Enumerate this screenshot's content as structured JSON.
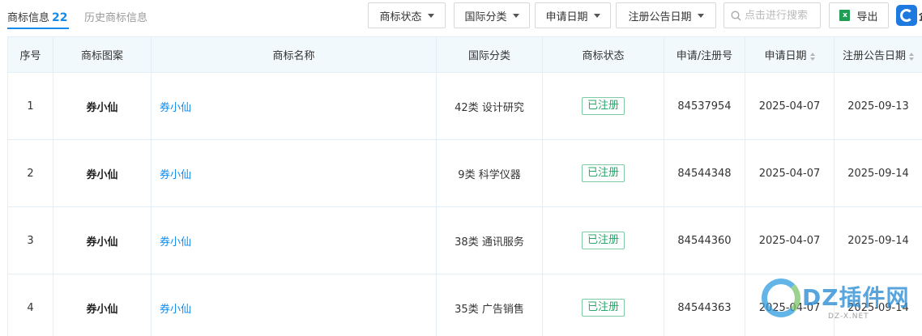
{
  "tabs": {
    "active_label": "商标信息",
    "active_count": "22",
    "history_label": "历史商标信息"
  },
  "filters": {
    "status": "商标状态",
    "intl_class": "国际分类",
    "apply_date": "申请日期",
    "announce_date": "注册公告日期"
  },
  "search": {
    "placeholder": "点击进行搜索"
  },
  "export": {
    "label": "导出",
    "icon": "excel-icon"
  },
  "table": {
    "headers": {
      "index": "序号",
      "pattern": "商标图案",
      "name": "商标名称",
      "intl_class": "国际分类",
      "status": "商标状态",
      "reg_no": "申请/注册号",
      "apply_date": "申请日期",
      "announce_date": "注册公告日期"
    },
    "rows": [
      {
        "index": "1",
        "pattern": "券小仙",
        "name": "券小仙",
        "intl_class": "42类 设计研究",
        "status": "已注册",
        "reg_no": "84537954",
        "apply_date": "2025-04-07",
        "announce_date": "2025-09-13"
      },
      {
        "index": "2",
        "pattern": "券小仙",
        "name": "券小仙",
        "intl_class": "9类 科学仪器",
        "status": "已注册",
        "reg_no": "84544348",
        "apply_date": "2025-04-07",
        "announce_date": "2025-09-14"
      },
      {
        "index": "3",
        "pattern": "券小仙",
        "name": "券小仙",
        "intl_class": "38类 通讯服务",
        "status": "已注册",
        "reg_no": "84544360",
        "apply_date": "2025-04-07",
        "announce_date": "2025-09-14"
      },
      {
        "index": "4",
        "pattern": "券小仙",
        "name": "券小仙",
        "intl_class": "35类 广告销售",
        "status": "已注册",
        "reg_no": "84544363",
        "apply_date": "2025-04-07",
        "announce_date": "2025-09-14"
      }
    ]
  },
  "watermark": {
    "brand": "DZ插件网",
    "sub": "DZ-X.NET"
  },
  "edge_char": "企",
  "colors": {
    "accent": "#128bed",
    "status_green": "#2aa56b",
    "header_bg": "#f2f9fc"
  }
}
